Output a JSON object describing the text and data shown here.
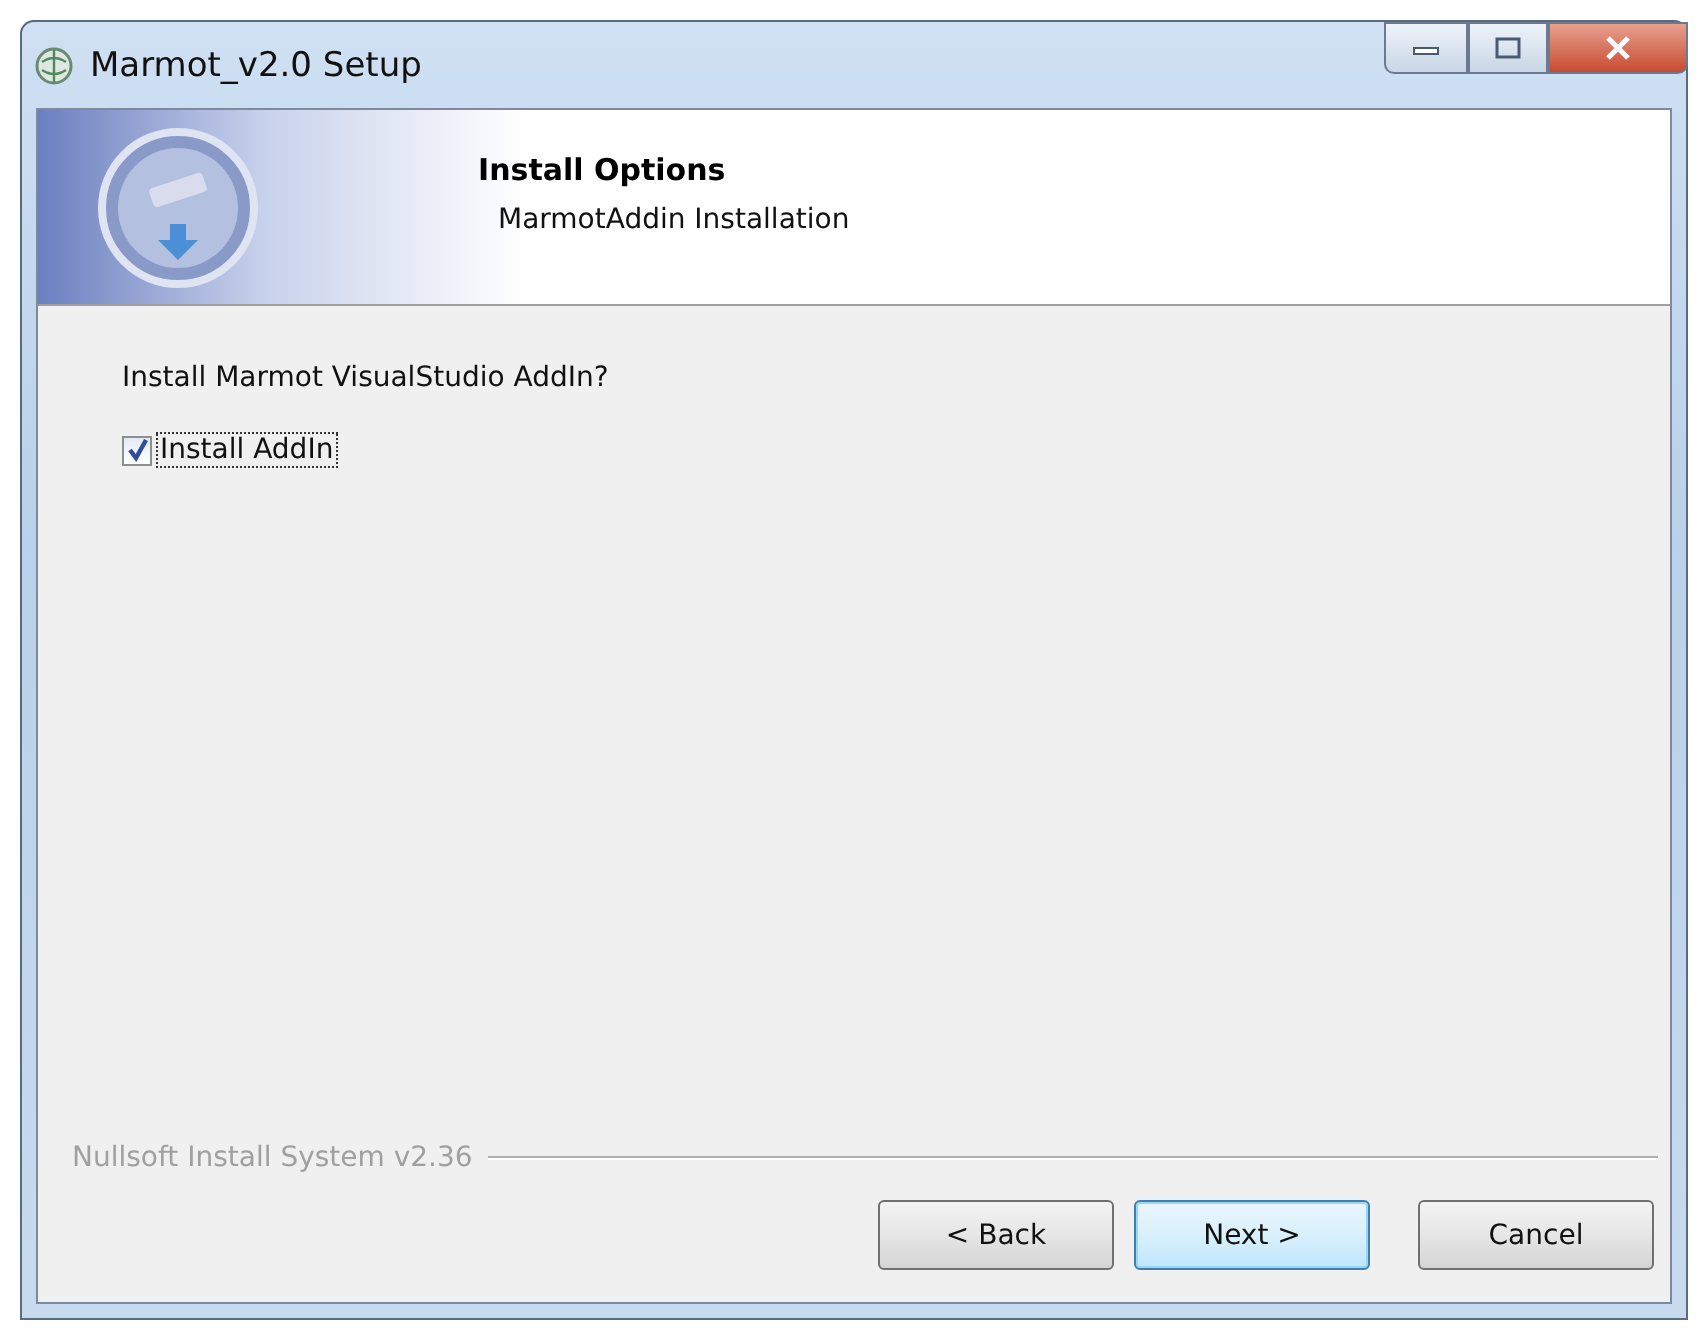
{
  "window": {
    "title": "Marmot_v2.0 Setup"
  },
  "header": {
    "title": "Install Options",
    "subtitle": "MarmotAddin Installation"
  },
  "body": {
    "question": "Install Marmot VisualStudio AddIn?",
    "checkbox": {
      "label": "Install AddIn",
      "checked": true
    }
  },
  "footer": {
    "branding": "Nullsoft Install System v2.36",
    "buttons": [
      {
        "label": "< Back",
        "focused": false
      },
      {
        "label": "Next >",
        "focused": true
      },
      {
        "label": "Cancel",
        "focused": false
      }
    ]
  }
}
